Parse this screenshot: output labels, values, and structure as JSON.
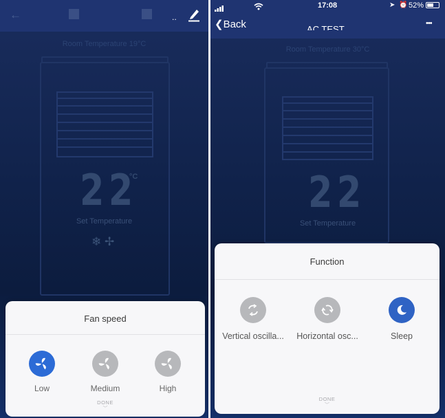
{
  "left": {
    "room_temperature": "Room Temperature  19°C",
    "header_dots": "..",
    "set_value": "22",
    "unit": "°C",
    "set_label": "Set Temperature",
    "mode_icons": "❄ ✢",
    "sheet": {
      "title": "Fan speed",
      "options": [
        {
          "label": "Low",
          "active": true
        },
        {
          "label": "Medium",
          "active": false
        },
        {
          "label": "High",
          "active": false
        }
      ],
      "done": "DONE"
    }
  },
  "right": {
    "status_bar": {
      "time": "17:08",
      "battery": "52%"
    },
    "back_label": "Back",
    "title": "AC TEST",
    "more": "•••",
    "room_temperature": "Room Temperature  30°C",
    "set_value": "22",
    "unit": "°C",
    "set_label": "Set Temperature",
    "sheet": {
      "title": "Function",
      "options": [
        {
          "label": "Vertical oscilla...",
          "active": false
        },
        {
          "label": "Horizontal osc...",
          "active": false
        },
        {
          "label": "Sleep",
          "active": true
        }
      ],
      "done": "DONE"
    }
  }
}
